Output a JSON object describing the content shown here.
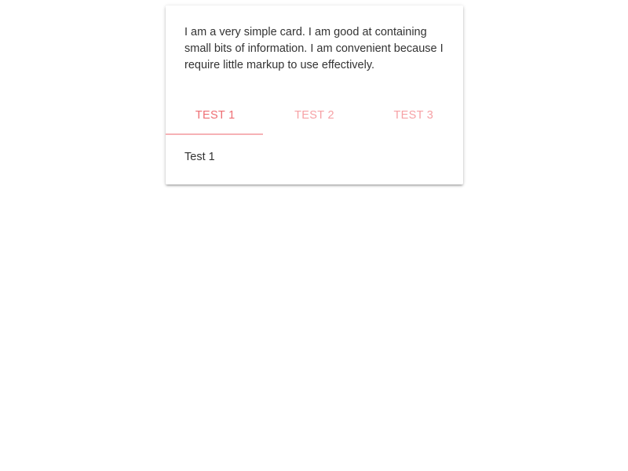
{
  "card": {
    "text": "I am a very simple card. I am good at containing small bits of information. I am convenient because I require little markup to use effectively."
  },
  "tabs": [
    {
      "label": "TEST 1",
      "active": true
    },
    {
      "label": "TEST 2",
      "active": false
    },
    {
      "label": "TEST 3",
      "active": false
    }
  ],
  "panel": {
    "text": "Test 1"
  },
  "colors": {
    "accent": "#ee6e73",
    "inactive_tab": "#f6a1a5",
    "indicator": "#f6b2b5"
  }
}
